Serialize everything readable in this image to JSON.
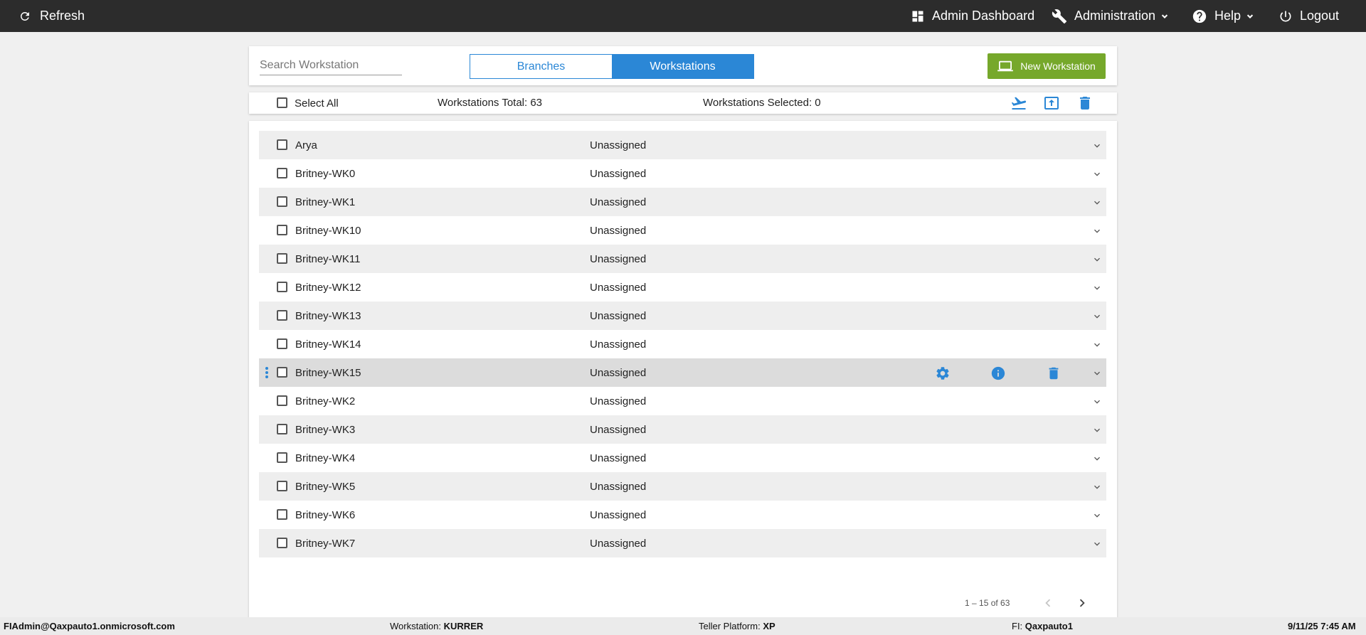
{
  "topbar": {
    "refresh_label": "Refresh",
    "admin_dashboard_label": "Admin Dashboard",
    "administration_label": "Administration",
    "help_label": "Help",
    "logout_label": "Logout"
  },
  "header": {
    "search_placeholder": "Search Workstation",
    "tabs": [
      {
        "label": "Branches",
        "active": false
      },
      {
        "label": "Workstations",
        "active": true
      }
    ],
    "new_button_label": "New Workstation"
  },
  "summary": {
    "select_all_label": "Select All",
    "total_text": "Workstations Total: 63",
    "selected_text": "Workstations Selected: 0"
  },
  "rows": [
    {
      "name": "Arya",
      "status": "Unassigned"
    },
    {
      "name": "Britney-WK0",
      "status": "Unassigned"
    },
    {
      "name": "Britney-WK1",
      "status": "Unassigned"
    },
    {
      "name": "Britney-WK10",
      "status": "Unassigned"
    },
    {
      "name": "Britney-WK11",
      "status": "Unassigned"
    },
    {
      "name": "Britney-WK12",
      "status": "Unassigned"
    },
    {
      "name": "Britney-WK13",
      "status": "Unassigned"
    },
    {
      "name": "Britney-WK14",
      "status": "Unassigned"
    },
    {
      "name": "Britney-WK15",
      "status": "Unassigned"
    },
    {
      "name": "Britney-WK2",
      "status": "Unassigned"
    },
    {
      "name": "Britney-WK3",
      "status": "Unassigned"
    },
    {
      "name": "Britney-WK4",
      "status": "Unassigned"
    },
    {
      "name": "Britney-WK5",
      "status": "Unassigned"
    },
    {
      "name": "Britney-WK6",
      "status": "Unassigned"
    },
    {
      "name": "Britney-WK7",
      "status": "Unassigned"
    }
  ],
  "pagination": {
    "range_text": "1 – 15 of 63"
  },
  "footer": {
    "user": "FIAdmin@Qaxpauto1.onmicrosoft.com",
    "workstation_label": "Workstation:",
    "workstation_value": "KURRER",
    "teller_label": "Teller Platform:",
    "teller_value": "XP",
    "fi_label": "FI:",
    "fi_value": "Qaxpauto1",
    "datetime": "9/11/25 7:45 AM"
  },
  "colors": {
    "accent": "#2b87d6",
    "topbar": "#2c2c2c",
    "new_button": "#76a82b"
  }
}
